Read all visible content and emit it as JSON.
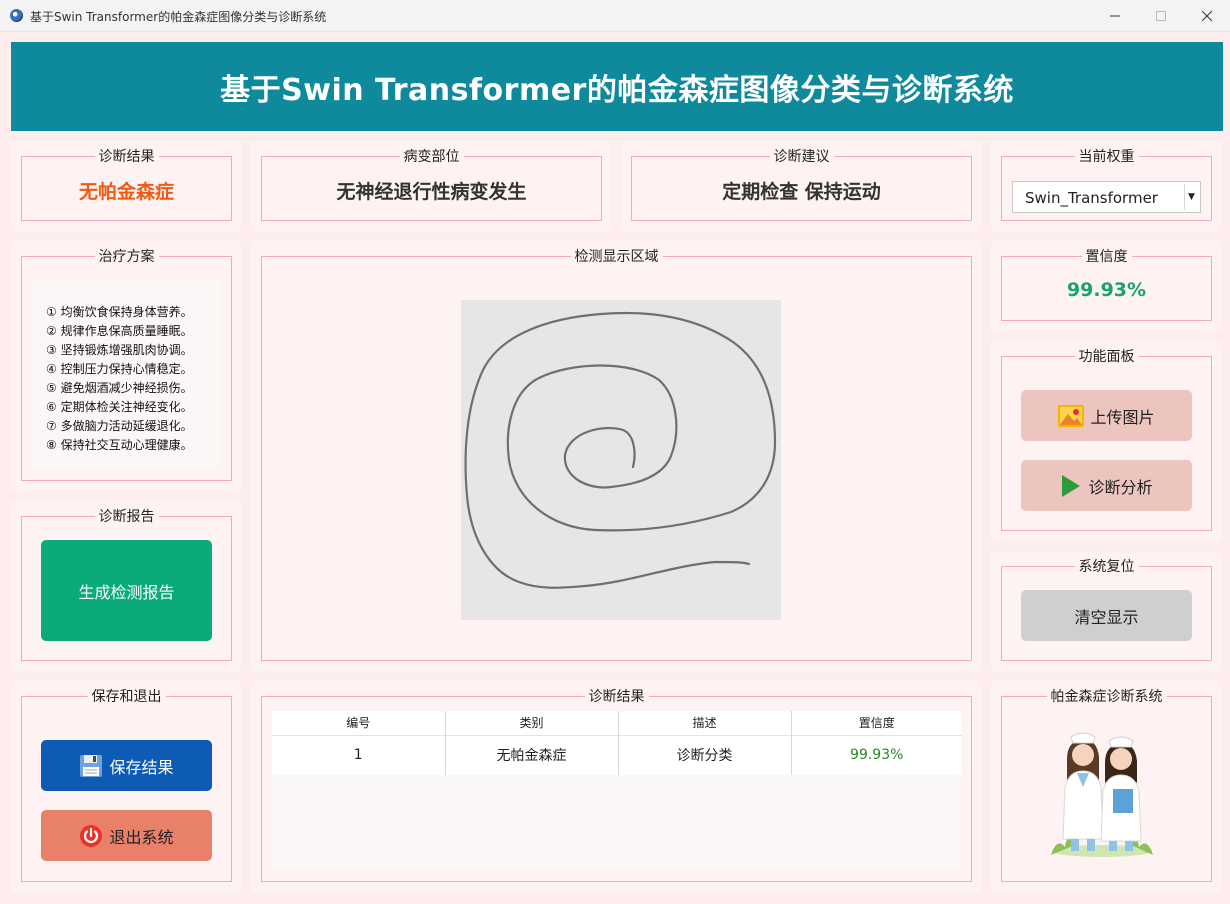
{
  "window": {
    "title": "基于Swin Transformer的帕金森症图像分类与诊断系统"
  },
  "banner": {
    "title": "基于Swin Transformer的帕金森症图像分类与诊断系统"
  },
  "diagnosis": {
    "title": "诊断结果",
    "value": "无帕金森症"
  },
  "lesion": {
    "title": "病变部位",
    "value": "无神经退行性病变发生"
  },
  "advice": {
    "title": "诊断建议",
    "value": "定期检查 保持运动"
  },
  "weights": {
    "title": "当前权重",
    "selected": "Swin_Transformer"
  },
  "treatment": {
    "title": "治疗方案",
    "items": [
      "① 均衡饮食保持身体营养。",
      "② 规律作息保高质量睡眠。",
      "③ 坚持锻炼增强肌肉协调。",
      "④ 控制压力保持心情稳定。",
      "⑤ 避免烟酒减少神经损伤。",
      "⑥ 定期体检关注神经变化。",
      "⑦ 多做脑力活动延缓退化。",
      "⑧ 保持社交互动心理健康。"
    ]
  },
  "display": {
    "title": "检测显示区域"
  },
  "confidence": {
    "title": "置信度",
    "value": "99.93%"
  },
  "functions": {
    "title": "功能面板",
    "upload_label": "上传图片",
    "analyze_label": "诊断分析"
  },
  "reset": {
    "title": "系统复位",
    "clear_label": "清空显示"
  },
  "report": {
    "title": "诊断报告",
    "generate_label": "生成检测报告"
  },
  "save_exit": {
    "title": "保存和退出",
    "save_label": "保存结果",
    "exit_label": "退出系统"
  },
  "results": {
    "title": "诊断结果",
    "headers": [
      "编号",
      "类别",
      "描述",
      "置信度"
    ],
    "rows": [
      [
        "1",
        "无帕金森症",
        "诊断分类",
        "99.93%"
      ]
    ]
  },
  "system_logo": {
    "title": "帕金森症诊断系统"
  },
  "colors": {
    "banner": "#0f8a9d",
    "diagnosis": "#f05a12",
    "confidence": "#1aa36b",
    "report_button": "#0aab79",
    "save_button": "#0d5bb5",
    "exit_button": "#e8806a",
    "func_button": "#ecc5bf",
    "clear_button": "#cfcfcf"
  }
}
